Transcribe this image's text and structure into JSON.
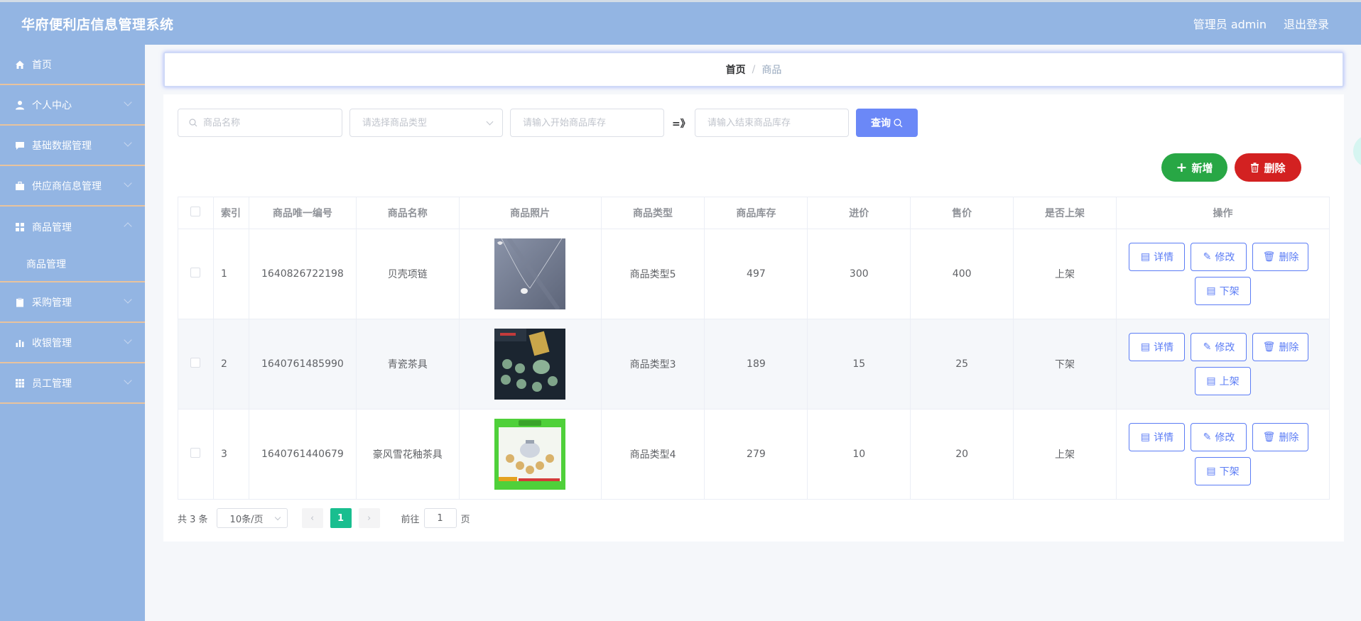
{
  "header": {
    "title": "华府便利店信息管理系统",
    "user_label": "管理员 admin",
    "logout_label": "退出登录"
  },
  "sidebar": {
    "items": [
      {
        "label": "首页",
        "icon": "home-icon"
      },
      {
        "label": "个人中心",
        "icon": "user-icon"
      },
      {
        "label": "基础数据管理",
        "icon": "chat-icon"
      },
      {
        "label": "供应商信息管理",
        "icon": "briefcase-icon"
      },
      {
        "label": "商品管理",
        "icon": "grid-icon"
      },
      {
        "label": "采购管理",
        "icon": "clipboard-icon"
      },
      {
        "label": "收银管理",
        "icon": "chart-icon"
      },
      {
        "label": "员工管理",
        "icon": "apps-icon"
      }
    ],
    "sub_item": "商品管理"
  },
  "breadcrumb": {
    "home": "首页",
    "separator": "/",
    "current": "商品"
  },
  "search": {
    "name_placeholder": "商品名称",
    "type_placeholder": "请选择商品类型",
    "stock_start_placeholder": "请输入开始商品库存",
    "range_sep": "=》",
    "stock_end_placeholder": "请输入结束商品库存",
    "query_label": "查询"
  },
  "actions": {
    "add_label": "新增",
    "delete_label": "删除"
  },
  "table": {
    "headers": [
      "索引",
      "商品唯一编号",
      "商品名称",
      "商品照片",
      "商品类型",
      "商品库存",
      "进价",
      "售价",
      "是否上架",
      "操作"
    ],
    "rows": [
      {
        "index": "1",
        "code": "1640826722198",
        "name": "贝壳项链",
        "type": "商品类型5",
        "stock": "497",
        "cost": "300",
        "price": "400",
        "shelf": "上架",
        "toggle": "下架"
      },
      {
        "index": "2",
        "code": "1640761485990",
        "name": "青瓷茶具",
        "type": "商品类型3",
        "stock": "189",
        "cost": "15",
        "price": "25",
        "shelf": "下架",
        "toggle": "上架"
      },
      {
        "index": "3",
        "code": "1640761440679",
        "name": "豪风雪花釉茶具",
        "type": "商品类型4",
        "stock": "279",
        "cost": "10",
        "price": "20",
        "shelf": "上架",
        "toggle": "下架"
      }
    ],
    "op_detail": "详情",
    "op_edit": "修改",
    "op_delete": "删除"
  },
  "pagination": {
    "total": "共 3 条",
    "page_size": "10条/页",
    "current_page": "1",
    "goto_prefix": "前往",
    "goto_value": "1",
    "goto_suffix": "页"
  },
  "colors": {
    "accent": "#5b7cf5",
    "header": "#93b5e3",
    "add": "#28a745",
    "delete": "#d32121",
    "page_active": "#19be8f"
  }
}
